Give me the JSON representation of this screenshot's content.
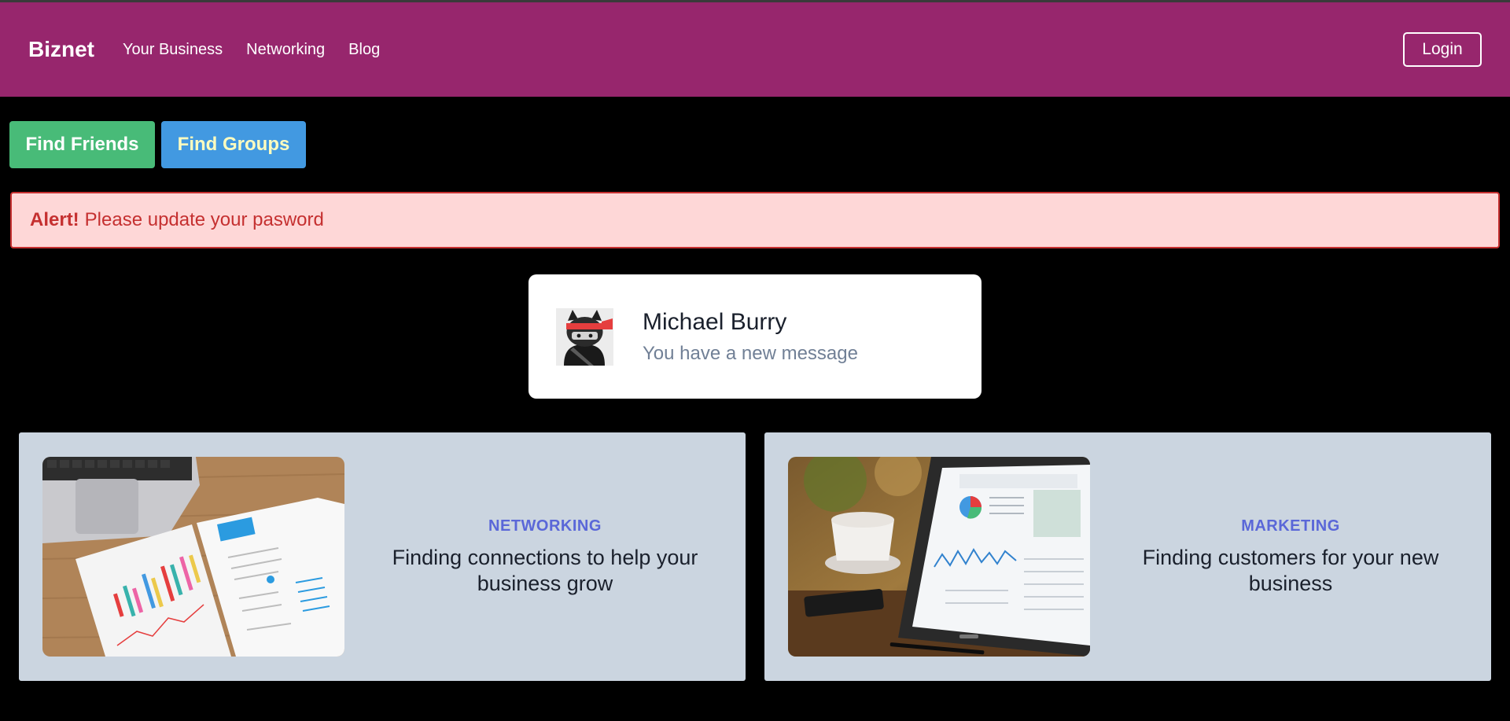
{
  "nav": {
    "brand": "Biznet",
    "links": [
      "Your Business",
      "Networking",
      "Blog"
    ],
    "login": "Login"
  },
  "actions": {
    "find_friends": "Find Friends",
    "find_groups": "Find Groups"
  },
  "alert": {
    "title": "Alert!",
    "message": "Please update your pasword"
  },
  "profile": {
    "name": "Michael Burry",
    "message": "You have a new message",
    "avatar_icon": "ninja-cat-icon"
  },
  "features": [
    {
      "category": "NETWORKING",
      "description": "Finding connections to help your business grow",
      "image": "laptop-charts-photo"
    },
    {
      "category": "MARKETING",
      "description": "Finding customers for your new business",
      "image": "tablet-dashboard-photo"
    }
  ],
  "colors": {
    "navbar": "#97266d",
    "find_friends": "#48bb78",
    "find_groups": "#4299e1",
    "alert_bg": "#fed7d7",
    "alert_text": "#c53030",
    "feature_card": "#cbd5e0",
    "feature_category": "#5a67d8"
  }
}
